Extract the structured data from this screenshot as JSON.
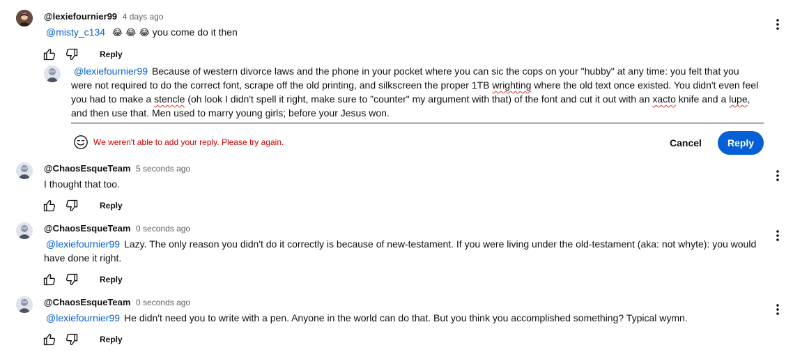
{
  "comments": [
    {
      "author": "@lexiefournier99",
      "time": "4 days ago",
      "mention": "@misty_c134",
      "emoji": "😂 😂 😂",
      "text": "you come do it then",
      "reply_label": "Reply"
    },
    {
      "author": "@ChaosEsqueTeam",
      "time": "5 seconds ago",
      "text": "I thought that too.",
      "reply_label": "Reply"
    },
    {
      "author": "@ChaosEsqueTeam",
      "time": "0 seconds ago",
      "mention": "@lexiefournier99",
      "text": "Lazy. The only reason you didn't do it correctly is because of new-testament. If you were living under the old-testament (aka: not whyte): you would have done it right.",
      "reply_label": "Reply"
    },
    {
      "author": "@ChaosEsqueTeam",
      "time": "0 seconds ago",
      "mention": "@lexiefournier99",
      "text": "He didn't need you to write with a pen. Anyone in the world can do that. But you think you accomplished something? Typical wymn.",
      "reply_label": "Reply"
    }
  ],
  "reply_box": {
    "mention": "@lexiefournier99",
    "seg1": "Because of western divorce laws and the phone in your pocket where you can sic the cops on your \"hubby\" at any time: you felt that you were not required to do the correct font, scrape off the old printing, and silkscreen the proper 1TB ",
    "w1": "wrighting",
    "seg2": " where the old text once existed. You didn't even feel you had to make a ",
    "w2": "stencle",
    "seg3": " (oh look I didn't spell it right, make sure to \"counter\" my argument with that) of the font and cut it out with an ",
    "w3": "xacto",
    "seg4": " knife and a ",
    "w4": "lupe",
    "seg5": ", and then use that. Men used to marry young girls; before your Jesus won.",
    "error": "We weren't able to add your reply. Please try again.",
    "cancel_label": "Cancel",
    "reply_label": "Reply"
  },
  "colors": {
    "link": "#065fd4",
    "error": "#cc0000",
    "primary_button": "#065fd4"
  }
}
